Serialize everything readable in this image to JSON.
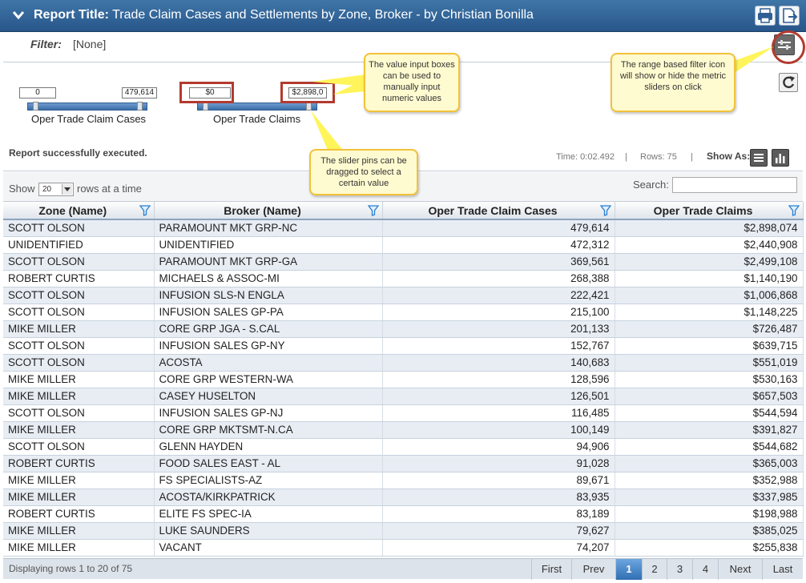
{
  "report": {
    "title_prefix": "Report Title:",
    "title": "Trade Claim Cases and Settlements by Zone, Broker - by Christian Bonilla"
  },
  "filter": {
    "label": "Filter:",
    "value": "[None]"
  },
  "sliders": [
    {
      "min_value": "0",
      "max_value": "479,614",
      "label": "Oper Trade Claim Cases"
    },
    {
      "min_value": "$0",
      "max_value": "$2,898,0",
      "label": "Oper Trade Claims"
    }
  ],
  "status": {
    "message": "Report successfully executed.",
    "time": "Time: 0:02.492",
    "sep": "|",
    "rows": "Rows: 75",
    "show_as": "Show As:"
  },
  "controls": {
    "show_label": "Show",
    "rows_value": "20",
    "rows_label": "rows at a time",
    "search_label": "Search:"
  },
  "table": {
    "columns": [
      "Zone (Name)",
      "Broker (Name)",
      "Oper Trade Claim Cases",
      "Oper Trade Claims"
    ],
    "rows": [
      [
        "SCOTT OLSON",
        "PARAMOUNT MKT GRP-NC",
        "479,614",
        "$2,898,074"
      ],
      [
        "UNIDENTIFIED",
        "UNIDENTIFIED",
        "472,312",
        "$2,440,908"
      ],
      [
        "SCOTT OLSON",
        "PARAMOUNT MKT GRP-GA",
        "369,561",
        "$2,499,108"
      ],
      [
        "ROBERT CURTIS",
        "MICHAELS & ASSOC-MI",
        "268,388",
        "$1,140,190"
      ],
      [
        "SCOTT OLSON",
        "INFUSION SLS-N ENGLA",
        "222,421",
        "$1,006,868"
      ],
      [
        "SCOTT OLSON",
        "INFUSION SALES GP-PA",
        "215,100",
        "$1,148,225"
      ],
      [
        "MIKE MILLER",
        "CORE GRP JGA - S.CAL",
        "201,133",
        "$726,487"
      ],
      [
        "SCOTT OLSON",
        "INFUSION SALES GP-NY",
        "152,767",
        "$639,715"
      ],
      [
        "SCOTT OLSON",
        "ACOSTA",
        "140,683",
        "$551,019"
      ],
      [
        "MIKE MILLER",
        "CORE GRP WESTERN-WA",
        "128,596",
        "$530,163"
      ],
      [
        "MIKE MILLER",
        "CASEY HUSELTON",
        "126,501",
        "$657,503"
      ],
      [
        "SCOTT OLSON",
        "INFUSION SALES GP-NJ",
        "116,485",
        "$544,594"
      ],
      [
        "MIKE MILLER",
        "CORE GRP MKTSMT-N.CA",
        "100,149",
        "$391,827"
      ],
      [
        "SCOTT OLSON",
        "GLENN HAYDEN",
        "94,906",
        "$544,682"
      ],
      [
        "ROBERT CURTIS",
        "FOOD SALES EAST - AL",
        "91,028",
        "$365,003"
      ],
      [
        "MIKE MILLER",
        "FS SPECIALISTS-AZ",
        "89,671",
        "$352,988"
      ],
      [
        "MIKE MILLER",
        "ACOSTA/KIRKPATRICK",
        "83,935",
        "$337,985"
      ],
      [
        "ROBERT CURTIS",
        "ELITE FS SPEC-IA",
        "83,189",
        "$198,988"
      ],
      [
        "MIKE MILLER",
        "LUKE SAUNDERS",
        "79,627",
        "$385,025"
      ],
      [
        "MIKE MILLER",
        "VACANT",
        "74,207",
        "$255,838"
      ]
    ]
  },
  "footer": {
    "info": "Displaying rows 1 to 20 of 75",
    "first": "First",
    "prev": "Prev",
    "pages": [
      "1",
      "2",
      "3",
      "4"
    ],
    "next": "Next",
    "last": "Last"
  },
  "callouts": {
    "value_inputs": "The value input boxes can be used to manually input numeric values",
    "range_filter": "The range based filter icon will show or hide the metric sliders on click",
    "slider_pins": "The slider pins can be dragged to select a certain value"
  },
  "colors": {
    "title_bar": "#2f5f94",
    "highlight": "#b33a2f",
    "callout_fill": "#fffbd0",
    "active_page": "#3b7cc0"
  }
}
